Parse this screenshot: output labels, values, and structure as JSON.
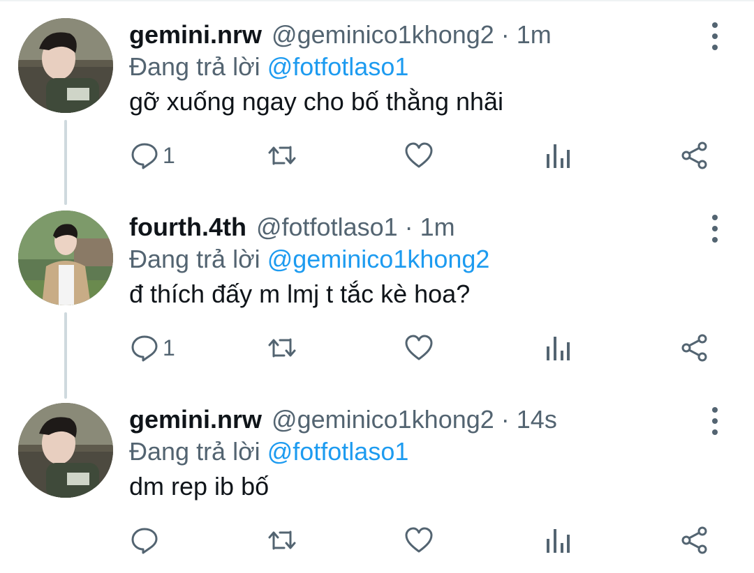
{
  "tweets": [
    {
      "display_name": "gemini.nrw",
      "handle": "@geminico1khong2",
      "separator": "·",
      "time": "1m",
      "reply_prefix": "Đang trả lời",
      "reply_to": "@fotfotlaso1",
      "text": "gỡ xuống ngay cho bố thằng nhãi",
      "reply_count": "1",
      "avatar": "avatar-photo"
    },
    {
      "display_name": "fourth.4th",
      "handle": "@fotfotlaso1",
      "separator": "·",
      "time": "1m",
      "reply_prefix": "Đang trả lời",
      "reply_to": "@geminico1khong2",
      "text": "đ thích đấy m lmj t tắc kè hoa?",
      "reply_count": "1",
      "avatar": "avatar-photo"
    },
    {
      "display_name": "gemini.nrw",
      "handle": "@geminico1khong2",
      "separator": "·",
      "time": "14s",
      "reply_prefix": "Đang trả lời",
      "reply_to": "@fotfotlaso1",
      "text": "dm rep ib bố",
      "reply_count": "",
      "avatar": "avatar-photo"
    }
  ],
  "icons": [
    "reply-icon",
    "retweet-icon",
    "like-icon",
    "views-icon",
    "share-icon",
    "more-icon"
  ],
  "colors": {
    "text": "#0f1419",
    "secondary": "#536471",
    "mention": "#1d9bf0",
    "thread_line": "#cfd9de"
  }
}
